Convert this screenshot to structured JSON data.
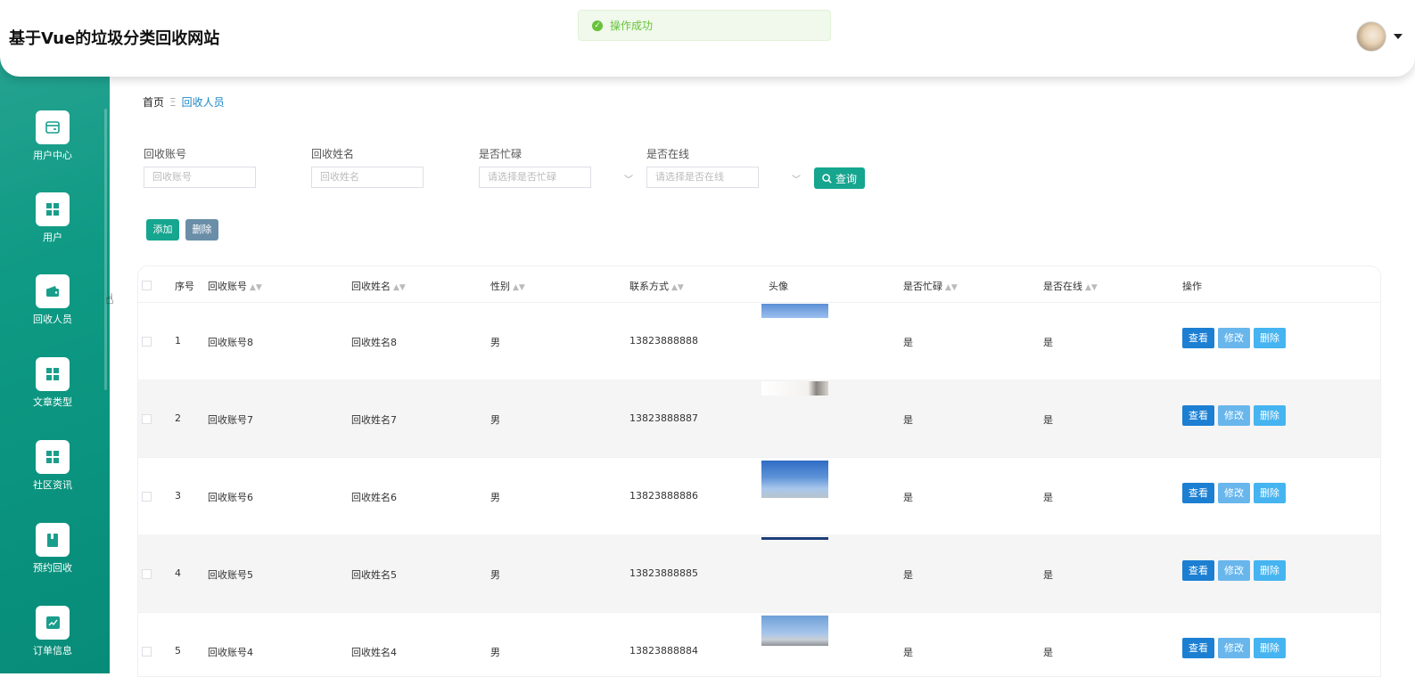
{
  "app": {
    "title": "基于Vue的垃圾分类回收网站"
  },
  "toast": {
    "text": "操作成功",
    "icon": "success-check-icon"
  },
  "sidebar": {
    "items": [
      {
        "label": "用户中心",
        "icon": "card-icon"
      },
      {
        "label": "用户",
        "icon": "grid-icon"
      },
      {
        "label": "回收人员",
        "icon": "wallet-icon"
      },
      {
        "label": "文章类型",
        "icon": "grid-icon"
      },
      {
        "label": "社区资讯",
        "icon": "grid-icon"
      },
      {
        "label": "预约回收",
        "icon": "book-icon"
      },
      {
        "label": "订单信息",
        "icon": "chart-icon"
      }
    ]
  },
  "breadcrumb": {
    "home": "首页",
    "separator": "Ξ",
    "current": "回收人员"
  },
  "search": {
    "fields": [
      {
        "label": "回收账号",
        "placeholder": "回收账号"
      },
      {
        "label": "回收姓名",
        "placeholder": "回收姓名"
      },
      {
        "label": "是否忙碌",
        "placeholder": "请选择是否忙碌"
      },
      {
        "label": "是否在线",
        "placeholder": "请选择是否在线"
      }
    ],
    "button": "查询"
  },
  "actions": {
    "add": "添加",
    "delete": "删除"
  },
  "table": {
    "headers": [
      "序号",
      "回收账号",
      "回收姓名",
      "性别",
      "联系方式",
      "头像",
      "是否忙碌",
      "是否在线",
      "操作"
    ],
    "op_labels": {
      "view": "查看",
      "edit": "修改",
      "delete": "删除"
    },
    "rows": [
      {
        "index": "1",
        "account": "回收账号8",
        "name": "回收姓名8",
        "gender": "男",
        "phone": "13823888888",
        "busy": "是",
        "online": "是"
      },
      {
        "index": "2",
        "account": "回收账号7",
        "name": "回收姓名7",
        "gender": "男",
        "phone": "13823888887",
        "busy": "是",
        "online": "是"
      },
      {
        "index": "3",
        "account": "回收账号6",
        "name": "回收姓名6",
        "gender": "男",
        "phone": "13823888886",
        "busy": "是",
        "online": "是"
      },
      {
        "index": "4",
        "account": "回收账号5",
        "name": "回收姓名5",
        "gender": "男",
        "phone": "13823888885",
        "busy": "是",
        "online": "是"
      },
      {
        "index": "5",
        "account": "回收账号4",
        "name": "回收姓名4",
        "gender": "男",
        "phone": "13823888884",
        "busy": "是",
        "online": "是"
      }
    ]
  }
}
